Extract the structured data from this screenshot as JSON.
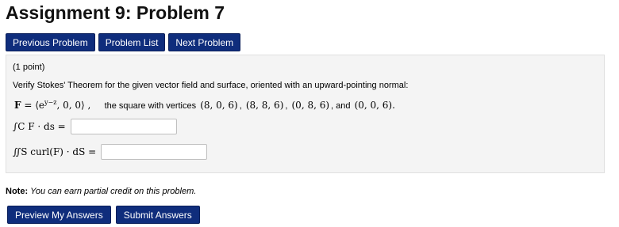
{
  "page": {
    "title": "Assignment 9: Problem 7"
  },
  "nav": {
    "previous_label": "Previous Problem",
    "list_label": "Problem List",
    "next_label": "Next Problem"
  },
  "problem": {
    "points": "(1 point)",
    "statement": "Verify Stokes' Theorem for the given vector field and surface, oriented with an upward-pointing normal:",
    "field_bold_F": "F",
    "field_eq": " = ⟨e",
    "field_exp": "y−z",
    "field_rest": ", 0, 0⟩ ,",
    "surface_text": "the square with vertices",
    "v1": "(8, 0, 6)",
    "v2": "(8, 8, 6)",
    "v3": "(0, 8, 6)",
    "and_text": ", and",
    "v4": "(0, 0, 6).",
    "line_integral_label": "∫C F · ds =",
    "surface_integral_label": "∬S curl(F) · dS =",
    "line_integral_value": "",
    "surface_integral_value": ""
  },
  "note": {
    "label": "Note:",
    "text": "You can earn partial credit on this problem."
  },
  "submit": {
    "preview_label": "Preview My Answers",
    "submit_label": "Submit Answers"
  },
  "colors": {
    "button_bg": "#0f2d7c",
    "panel_bg": "#f4f4f4"
  }
}
